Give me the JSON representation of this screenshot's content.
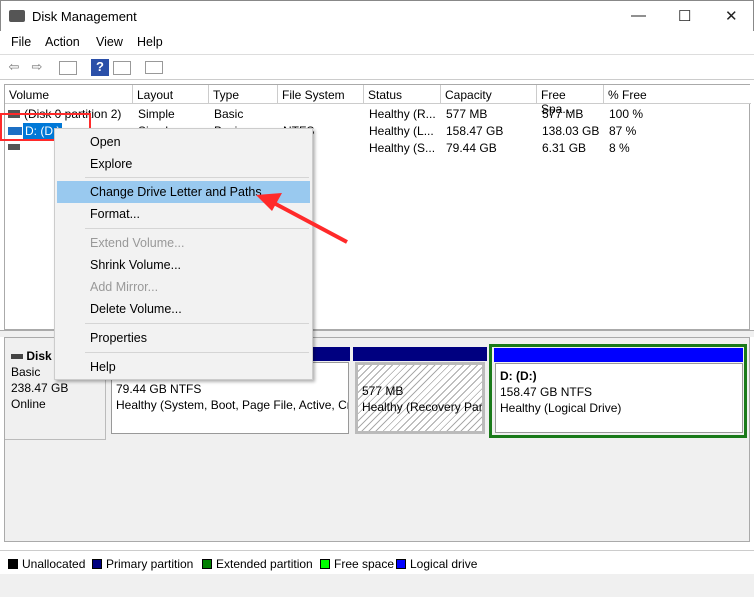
{
  "window": {
    "title": "Disk Management",
    "minimize": "—",
    "maximize": "☐",
    "close": "✕"
  },
  "menu": [
    "File",
    "Action",
    "View",
    "Help"
  ],
  "toolbar": {
    "icons": [
      "back-arrow-icon",
      "forward-arrow-icon",
      "console-tree-icon",
      "help-icon",
      "action-pane-icon",
      "properties-icon"
    ]
  },
  "columns": [
    "Volume",
    "Layout",
    "Type",
    "File System",
    "Status",
    "Capacity",
    "Free Spa...",
    "% Free"
  ],
  "rows": [
    [
      "(Disk 0 partition 2)",
      "Simple",
      "Basic",
      "",
      "Healthy (R...",
      "577 MB",
      "577 MB",
      "100 %"
    ],
    [
      "D: (D:)",
      "Simple",
      "Basic",
      "NTFS",
      "Healthy (L...",
      "158.47 GB",
      "138.03 GB",
      "87 %"
    ],
    [
      "",
      "",
      "",
      "",
      "Healthy (S...",
      "79.44 GB",
      "6.31 GB",
      "8 %"
    ]
  ],
  "disk": {
    "name": "Disk 0",
    "type": "Basic",
    "size": "238.47 GB",
    "status": "Online"
  },
  "partitions": [
    {
      "size": "79.44 GB NTFS",
      "status": "Healthy (System, Boot, Page File, Active, Cr"
    },
    {
      "size": "577 MB",
      "status": "Healthy (Recovery Part"
    },
    {
      "name": "D:  (D:)",
      "size": "158.47 GB NTFS",
      "status": "Healthy (Logical Drive)"
    }
  ],
  "legend": [
    {
      "label": "Unallocated",
      "color": "#000000"
    },
    {
      "label": "Primary partition",
      "color": "#000080"
    },
    {
      "label": "Extended partition",
      "color": "#008000"
    },
    {
      "label": "Free space",
      "color": "#00ff00"
    },
    {
      "label": "Logical drive",
      "color": "#0000ff"
    }
  ],
  "context_menu": [
    {
      "label": "Open",
      "enabled": true
    },
    {
      "label": "Explore",
      "enabled": true
    },
    {
      "label": "Change Drive Letter and Paths...",
      "enabled": true,
      "highlighted": true
    },
    {
      "label": "Format...",
      "enabled": true
    },
    {
      "label": "Extend Volume...",
      "enabled": false
    },
    {
      "label": "Shrink Volume...",
      "enabled": true
    },
    {
      "label": "Add Mirror...",
      "enabled": false
    },
    {
      "label": "Delete Volume...",
      "enabled": true
    },
    {
      "label": "Properties",
      "enabled": true
    },
    {
      "label": "Help",
      "enabled": true
    }
  ],
  "colors": {
    "highlight": "#99c9ef",
    "annotation": "#ff2a2a",
    "selection": "#0078d7"
  }
}
